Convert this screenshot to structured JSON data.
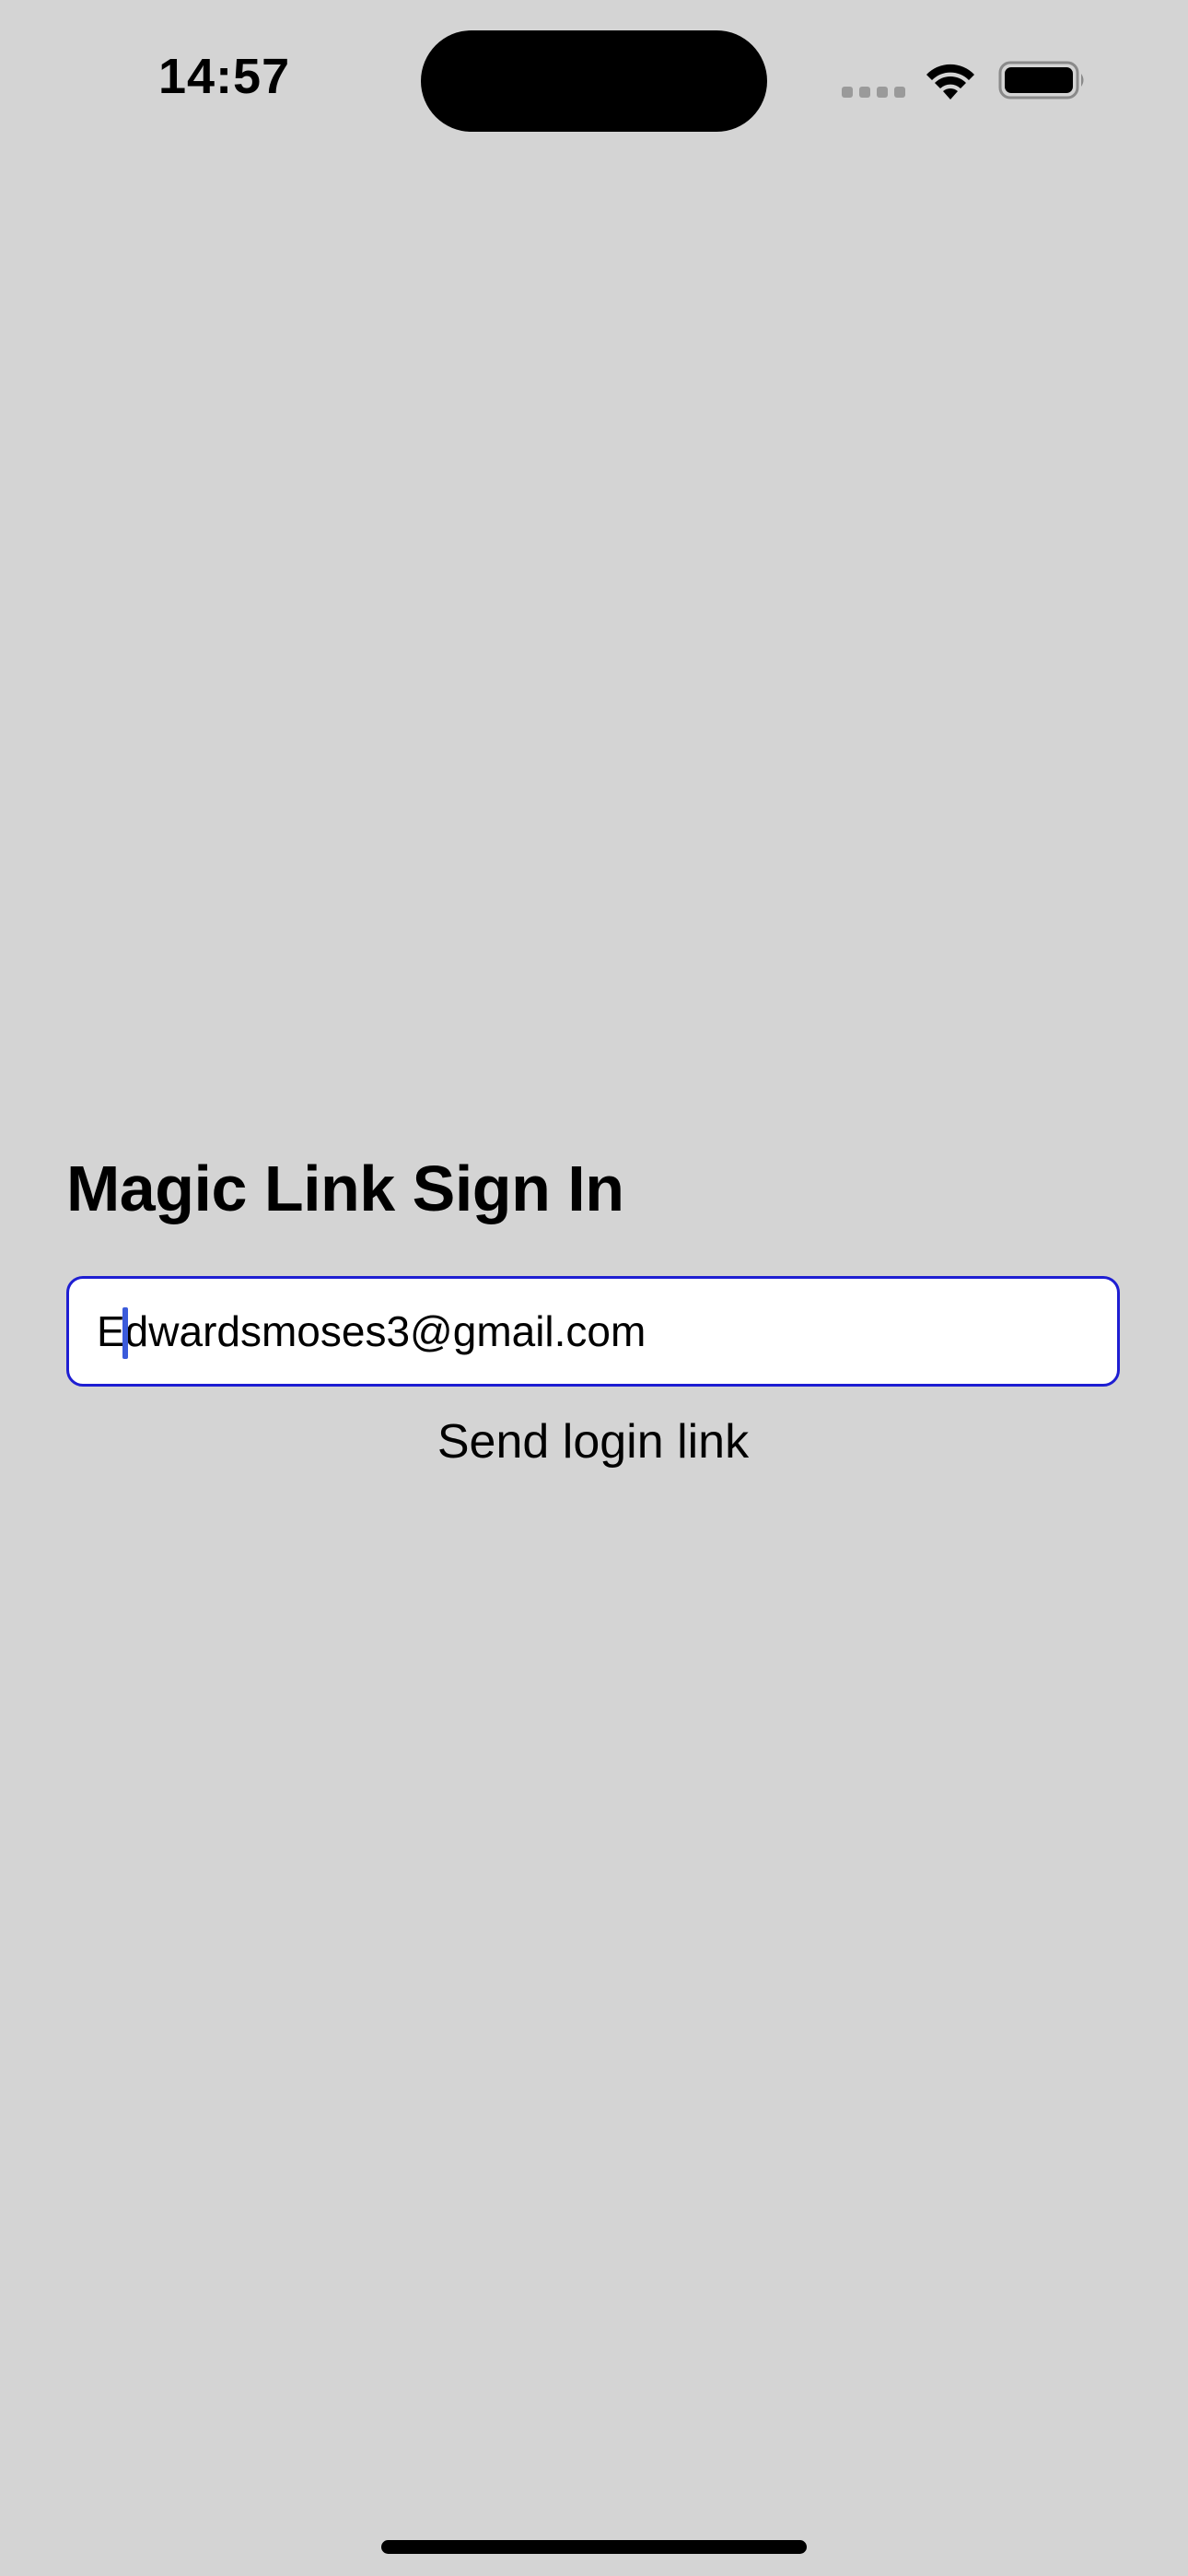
{
  "status_bar": {
    "time": "14:57",
    "icons": [
      "cellular-signal-icon",
      "wifi-icon",
      "battery-icon"
    ]
  },
  "screen": {
    "title": "Magic Link Sign In",
    "email_input": {
      "value": "Edwardsmoses3@gmail.com",
      "placeholder": ""
    },
    "send_button_label": "Send login link"
  },
  "colors": {
    "background": "#d4d4d4",
    "input_border": "#1e1ed2",
    "caret": "#3b5bdb",
    "text": "#000000"
  }
}
